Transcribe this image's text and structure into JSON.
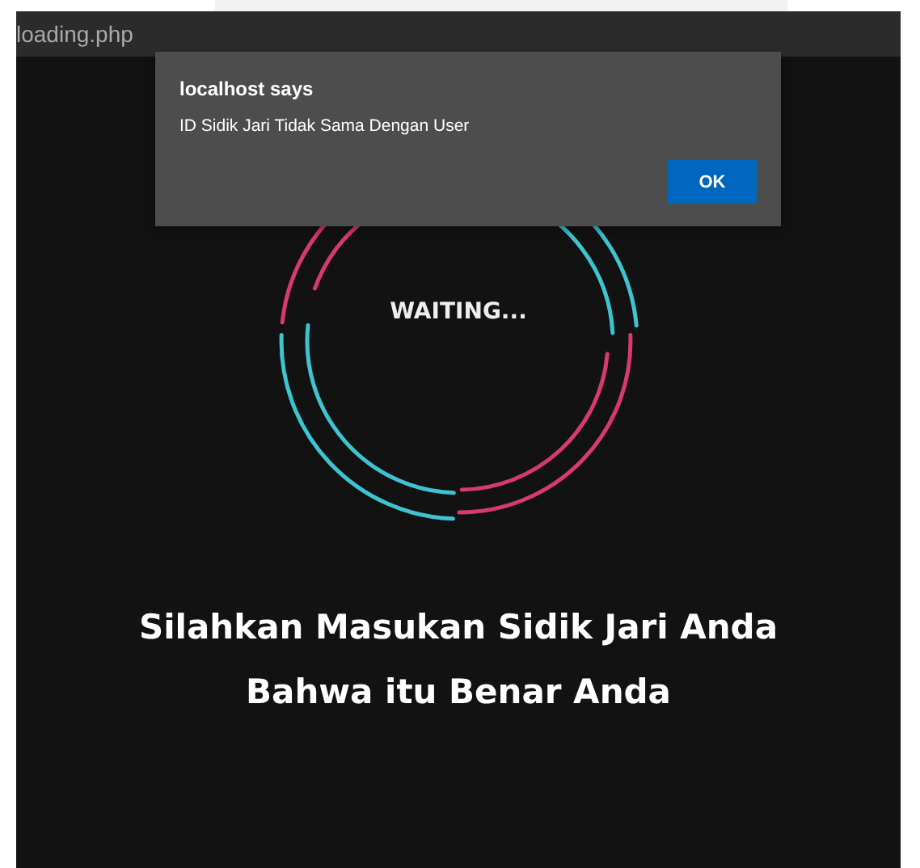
{
  "tab": {
    "title": "loading.php"
  },
  "dialog": {
    "title": "localhost says",
    "message": "ID Sidik Jari Tidak Sama Dengan User",
    "button": "OK"
  },
  "spinner": {
    "label": "WAITING..."
  },
  "message_lines": [
    "Silahkan Masukan Sidik Jari Anda",
    "Bahwa itu Benar Anda"
  ]
}
